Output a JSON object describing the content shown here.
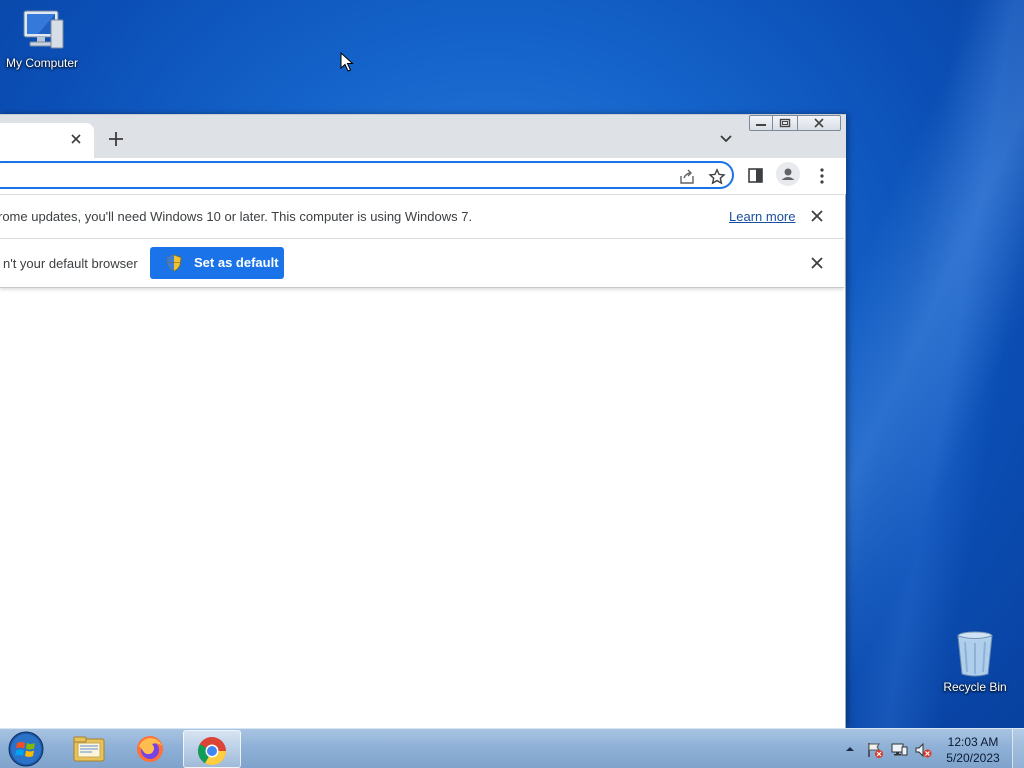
{
  "desktop": {
    "icons": [
      {
        "label": "My Computer",
        "icon": "computer-icon"
      },
      {
        "label": "Recycle Bin",
        "icon": "recycle-bin-icon"
      }
    ],
    "colors": {
      "background": "#1565cc"
    }
  },
  "browser": {
    "tab": {
      "title": "",
      "close_icon": "close-icon"
    },
    "new_tab_icon": "plus-icon",
    "tab_search_icon": "chevron-down-icon",
    "window_controls": [
      "minimize",
      "maximize",
      "close"
    ],
    "address_bar": {
      "value": ""
    },
    "toolbar_icons": [
      "share-icon",
      "star-icon",
      "side-panel-icon",
      "profile-avatar",
      "menu-icon"
    ],
    "infobars": {
      "update": {
        "message": "rome updates, you'll need Windows 10 or later. This computer is using Windows 7.",
        "link": "Learn more"
      },
      "default_browser": {
        "message": "n't your default browser",
        "button": "Set as default"
      }
    },
    "accent": "#1a73e8"
  },
  "taskbar": {
    "start_icon": "windows-start-icon",
    "apps": [
      "file-explorer-icon",
      "firefox-icon",
      "chrome-icon"
    ],
    "active_app": "chrome",
    "tray_icons": [
      "show-hidden-icons",
      "action-center-flag-icon",
      "network-icon",
      "volume-muted-icon"
    ],
    "clock": {
      "time": "12:03 AM",
      "date": "5/20/2023"
    }
  }
}
